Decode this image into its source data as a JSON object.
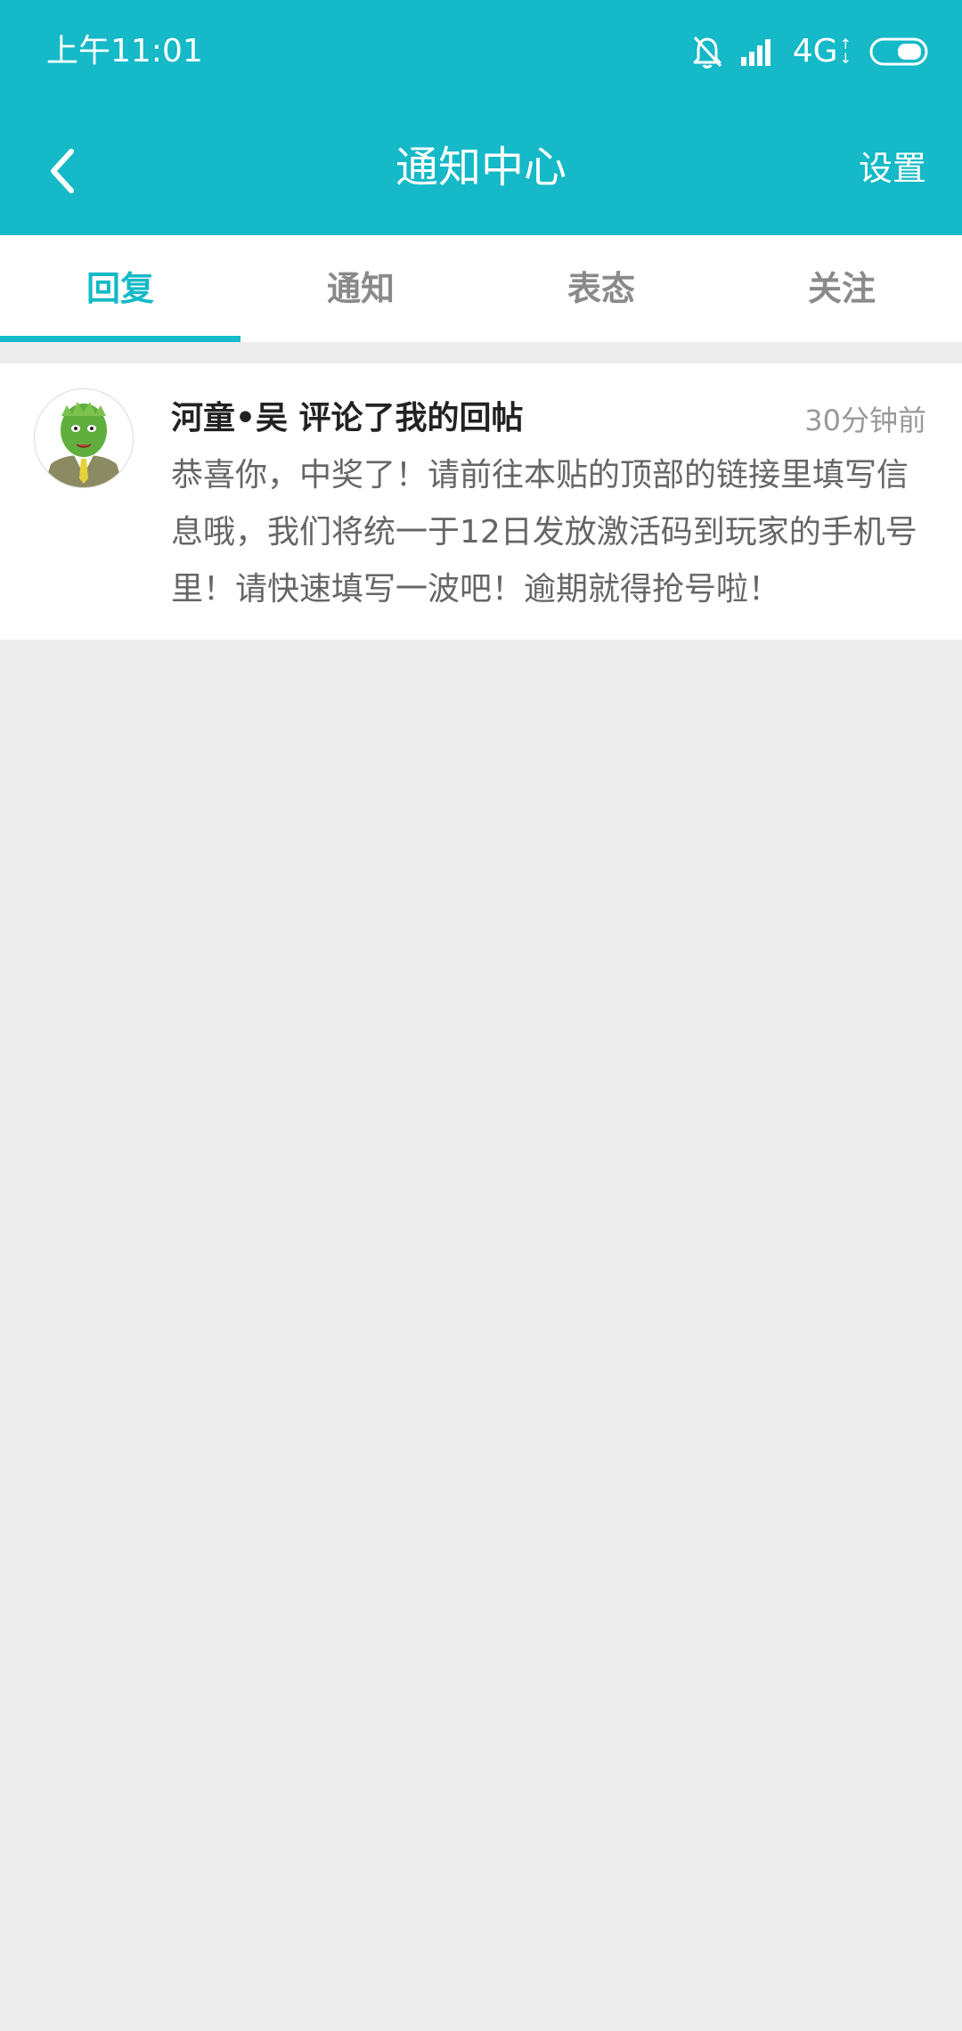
{
  "status_bar": {
    "time": "上午11:01",
    "network": "4G"
  },
  "nav": {
    "title": "通知中心",
    "settings_label": "设置"
  },
  "tabs": [
    {
      "label": "回复",
      "active": true
    },
    {
      "label": "通知",
      "active": false
    },
    {
      "label": "表态",
      "active": false
    },
    {
      "label": "关注",
      "active": false
    }
  ],
  "notifications": [
    {
      "title": "河童•吴 评论了我的回帖",
      "time": "30分钟前",
      "body": "恭喜你，中奖了！请前往本贴的顶部的链接里填写信息哦，我们将统一于12日发放激活码到玩家的手机号里！请快速填写一波吧！逾期就得抢号啦！"
    }
  ],
  "colors": {
    "accent": "#15b9c7",
    "page_background": "#ededed"
  }
}
